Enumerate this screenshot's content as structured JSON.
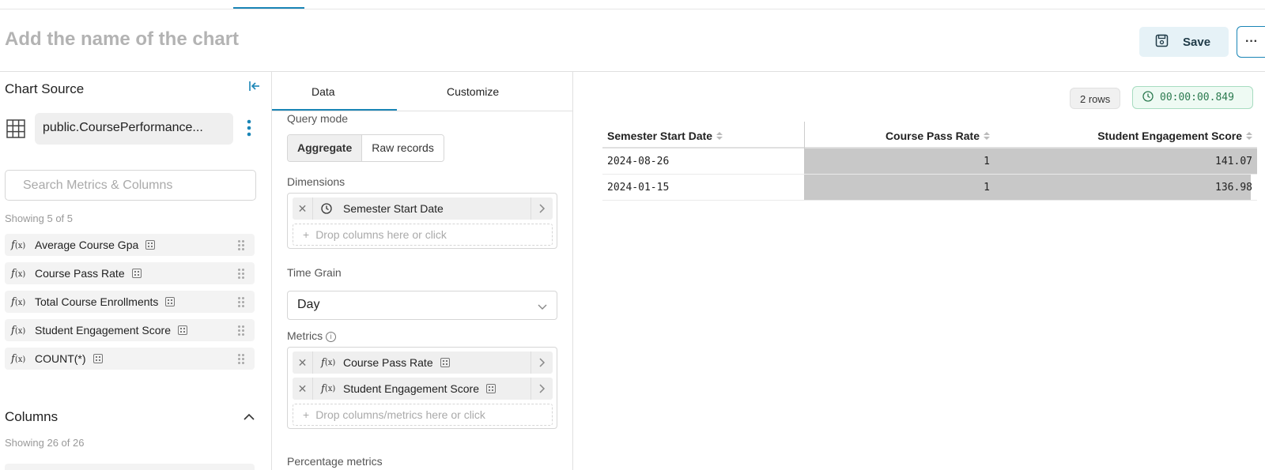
{
  "header": {
    "chart_name_placeholder": "Add the name of the chart",
    "save_label": "Save",
    "more_label": "···"
  },
  "sidebar": {
    "title": "Chart Source",
    "source_name": "public.CoursePerformance...",
    "search_placeholder": "Search Metrics & Columns",
    "metrics_showing": "Showing 5 of 5",
    "metrics": [
      {
        "fx": "f",
        "fx_args": "(x)",
        "label": "Average Course Gpa"
      },
      {
        "fx": "f",
        "fx_args": "(x)",
        "label": "Course Pass Rate"
      },
      {
        "fx": "f",
        "fx_args": "(x)",
        "label": "Total Course Enrollments"
      },
      {
        "fx": "f",
        "fx_args": "(x)",
        "label": "Student Engagement Score"
      },
      {
        "fx": "f",
        "fx_args": "(x)",
        "label": "COUNT(*)"
      }
    ],
    "columns_title": "Columns",
    "columns_showing": "Showing 26 of 26"
  },
  "config": {
    "tabs": [
      {
        "label": "Data"
      },
      {
        "label": "Customize"
      }
    ],
    "query_mode_label": "Query mode",
    "query_modes": [
      "Aggregate",
      "Raw records"
    ],
    "dimensions_label": "Dimensions",
    "dimension_pill": "Semester Start Date",
    "dimension_drop_hint": "Drop columns here or click",
    "time_grain_label": "Time Grain",
    "time_grain_value": "Day",
    "metrics_label": "Metrics",
    "metric_pills": [
      "Course Pass Rate",
      "Student Engagement Score"
    ],
    "metrics_drop_hint": "Drop columns/metrics here or click",
    "percentage_metrics_label": "Percentage metrics"
  },
  "results": {
    "rows_badge": "2 rows",
    "timer": "00:00:00.849",
    "columns": [
      "Semester Start Date",
      "Course Pass Rate",
      "Student Engagement Score"
    ],
    "rows": [
      {
        "date": "2024-08-26",
        "rate": "1",
        "score": "141.07",
        "bar_fraction": 1.0
      },
      {
        "date": "2024-01-15",
        "rate": "1",
        "score": "136.98",
        "bar_fraction": 0.986
      }
    ]
  },
  "colors": {
    "accent": "#1a85b6",
    "timer_green": "#2b7a4f",
    "bar_gray": "#c8c8c8"
  }
}
